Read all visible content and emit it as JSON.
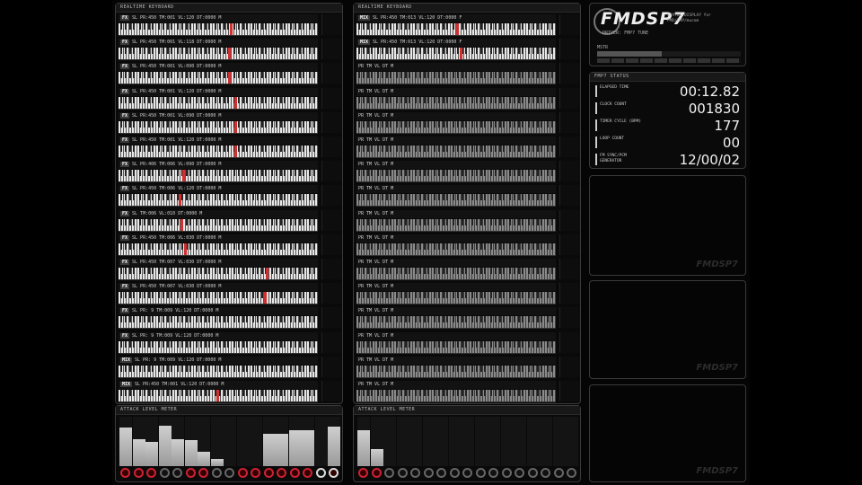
{
  "left_keyboard": {
    "title": "REALTIME KEYBOARD",
    "rows": [
      {
        "ch": "FX",
        "text": "SL PR:450 TM:001 VL:120 DT:0000 M",
        "note": 0.56
      },
      {
        "ch": "FX",
        "text": "SL PR:450 TM:001 VL:118 DT:0000 M",
        "note": 0.55
      },
      {
        "ch": "FX",
        "text": "SL PR:450 TM:001 VL:090 DT:0000 M",
        "note": 0.55
      },
      {
        "ch": "FX",
        "text": "SL PR:450 TM:001 VL:120 DT:0000 M",
        "note": 0.58
      },
      {
        "ch": "FX",
        "text": "SL PR:450 TM:001 VL:090 DT:0000 M",
        "note": 0.58
      },
      {
        "ch": "FX",
        "text": "SL PR:450 TM:001 VL:120 DT:0000 M",
        "note": 0.58
      },
      {
        "ch": "FX",
        "text": "SL PR:406 TM:006 VL:090 DT:0000 M",
        "note": 0.32
      },
      {
        "ch": "FX",
        "text": "SL PR:450 TM:006 VL:120 DT:0000 M",
        "note": 0.3
      },
      {
        "ch": "FX",
        "text": "SL TM:006 VL:010 DT:0000 M",
        "note": 0.31
      },
      {
        "ch": "FX",
        "text": "SL PR:450 TM:006 VL:030 DT:0000 M",
        "note": 0.33
      },
      {
        "ch": "FX",
        "text": "SL PR:450 TM:007 VL:030 DT:0000 M",
        "note": 0.74
      },
      {
        "ch": "FX",
        "text": "SL PR:450 TM:007 VL:030 DT:0000 M",
        "note": 0.73
      },
      {
        "ch": "FX",
        "text": "SL PR: 9 TM:009 VL:120 DT:0000 M",
        "note": -1
      },
      {
        "ch": "FX",
        "text": "SL PR: 9 TM:009 VL:120 DT:0000 M",
        "note": -1
      },
      {
        "ch": "MIX",
        "text": "SL PR: 9 TM:009 VL:120 DT:0000 M",
        "note": -1
      },
      {
        "ch": "MIX",
        "text": "SL PR:450 TM:001 VL:120 DT:0000 M",
        "note": 0.49
      }
    ]
  },
  "right_keyboard": {
    "title": "REALTIME KEYBOARD",
    "rows": [
      {
        "ch": "MIX",
        "text": "SL PR:450 TM:013 VL:120 DT:0000 F",
        "note": 0.5
      },
      {
        "ch": "MIX",
        "text": "SL PR:450 TM:013 VL:120 DT:0000 F",
        "note": 0.52
      },
      {
        "ch": "",
        "text": "PR  TM  VL  DT  M",
        "note": -1
      },
      {
        "ch": "",
        "text": "PR  TM  VL  DT  M",
        "note": -1
      },
      {
        "ch": "",
        "text": "PR  TM  VL  DT  M",
        "note": -1
      },
      {
        "ch": "",
        "text": "PR  TM  VL  DT  M",
        "note": -1
      },
      {
        "ch": "",
        "text": "PR  TM  VL  DT  M",
        "note": -1
      },
      {
        "ch": "",
        "text": "PR  TM  VL  DT  M",
        "note": -1
      },
      {
        "ch": "",
        "text": "PR  TM  VL  DT  M",
        "note": -1
      },
      {
        "ch": "",
        "text": "PR  TM  VL  DT  M",
        "note": -1
      },
      {
        "ch": "",
        "text": "PR  TM  VL  DT  M",
        "note": -1
      },
      {
        "ch": "",
        "text": "PR  TM  VL  DT  M",
        "note": -1
      },
      {
        "ch": "",
        "text": "PR  TM  VL  DT  M",
        "note": -1
      },
      {
        "ch": "",
        "text": "PR  TM  VL  DT  M",
        "note": -1
      },
      {
        "ch": "",
        "text": "PR  TM  VL  DT  M",
        "note": -1
      },
      {
        "ch": "",
        "text": "PR  TM  VL  DT  M",
        "note": -1
      }
    ]
  },
  "left_meter": {
    "title": "ATTACK LEVEL METER",
    "levels": [
      0.78,
      0.55,
      0.5,
      0.82,
      0.55,
      0.52,
      0.3,
      0.15,
      0.0,
      0.0,
      0.0,
      0.65,
      0.65,
      0.72,
      0.72,
      0.0,
      0.8
    ],
    "active": [
      true,
      true,
      true,
      false,
      false,
      true,
      true,
      false,
      false,
      true,
      true,
      true,
      true,
      true,
      true,
      false,
      true
    ]
  },
  "right_meter": {
    "title": "ATTACK LEVEL METER",
    "levels": [
      0.72,
      0.35,
      0,
      0,
      0,
      0,
      0,
      0,
      0,
      0,
      0,
      0,
      0,
      0,
      0,
      0,
      0
    ],
    "active": [
      true,
      true,
      false,
      false,
      false,
      false,
      false,
      false,
      false,
      false,
      false,
      false,
      false,
      false,
      false,
      false,
      false
    ]
  },
  "header": {
    "logo": "FMDSP7",
    "subtitle": "STATUS DISPLAY for PMD/FMP/mucom",
    "driver": "DRIVER: FMP7 TUNE",
    "volume_label": "MSTR",
    "volume": 0.45
  },
  "status": {
    "title": "FMP7 STATUS",
    "items": [
      {
        "key": "ELAPSED TIME",
        "value": "00:12.82"
      },
      {
        "key": "CLOCK COUNT",
        "value": "001830"
      },
      {
        "key": "TIMER CYCLE (BPM)",
        "value": "177"
      },
      {
        "key": "LOOP COUNT",
        "value": "00"
      },
      {
        "key": "FM SYNC/PCM GENERATOR",
        "value": "12/00/02"
      }
    ]
  },
  "watermark": "FMDSP7"
}
